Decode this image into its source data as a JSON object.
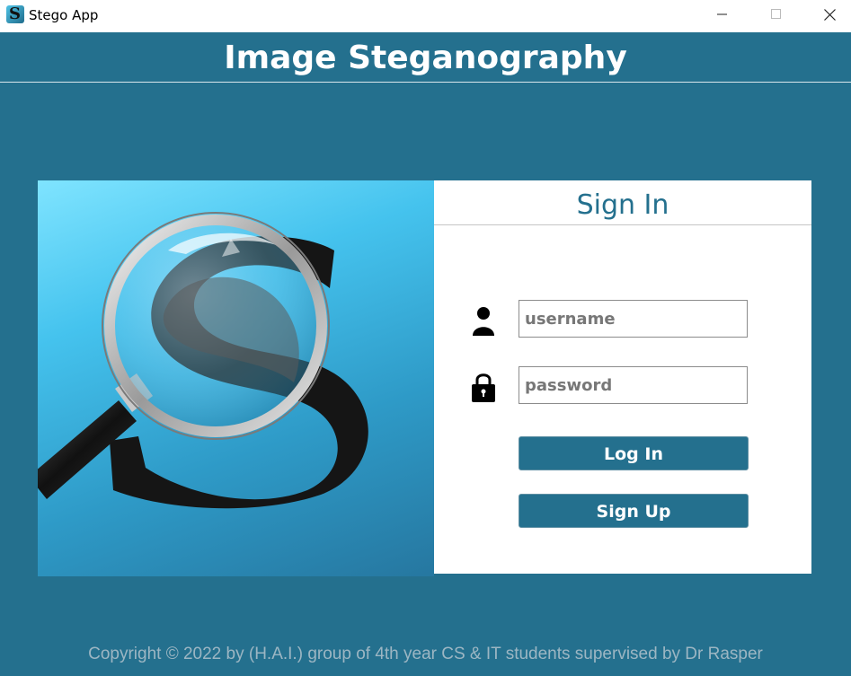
{
  "window": {
    "title": "Stego App",
    "icon": "stego-app-icon",
    "controls": {
      "minimize": "minimize-icon",
      "maximize": "maximize-icon",
      "close": "close-icon"
    }
  },
  "header": {
    "title": "Image Steganography"
  },
  "hero": {
    "image": "magnifying-glass-over-letter-s"
  },
  "signin": {
    "title": "Sign In",
    "username_placeholder": "username",
    "username_value": "",
    "password_placeholder": "password",
    "password_value": "",
    "login_label": "Log In",
    "signup_label": "Sign Up"
  },
  "footer": {
    "copyright": "Copyright © 2022 by (H.A.I.) group of 4th year CS & IT students supervised by Dr Rasper"
  },
  "colors": {
    "primary": "#24708e",
    "card": "#ffffff",
    "footer_text": "#9cb6c3"
  }
}
